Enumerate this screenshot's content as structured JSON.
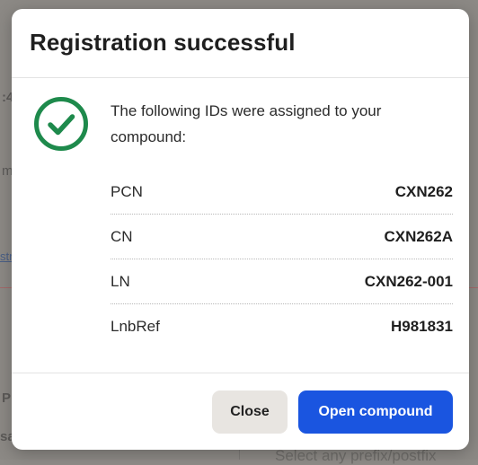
{
  "background": {
    "fragments": [
      ":4",
      "m",
      "P",
      "sa"
    ],
    "link_fragment": "str",
    "placeholder": "Select any prefix/postfix"
  },
  "dialog": {
    "title": "Registration successful",
    "message": "The following IDs were assigned to your compound:",
    "icon": "check-circle-icon",
    "icon_color": "#1e8a4c",
    "ids": [
      {
        "label": "PCN",
        "value": "CXN262"
      },
      {
        "label": "CN",
        "value": "CXN262A"
      },
      {
        "label": "LN",
        "value": "CXN262-001"
      },
      {
        "label": "LnbRef",
        "value": "H981831"
      }
    ],
    "buttons": {
      "close_label": "Close",
      "open_label": "Open compound",
      "primary_color": "#1a55e0"
    }
  }
}
